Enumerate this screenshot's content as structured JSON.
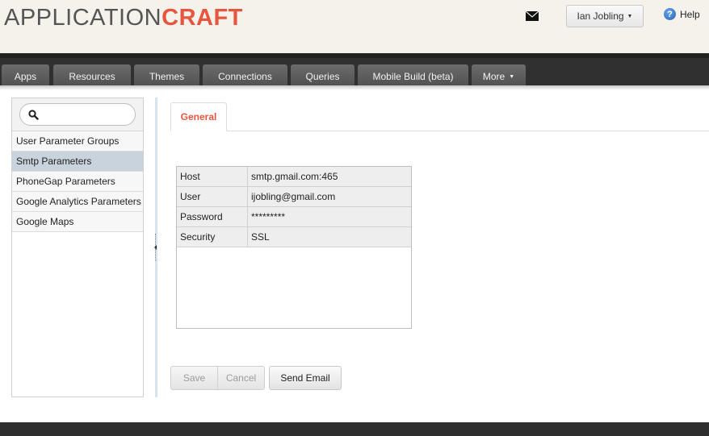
{
  "header": {
    "logo_part1": "APPLICATION",
    "logo_part2": "CRAFT",
    "user_name": "Ian Jobling",
    "help_label": "Help",
    "accent_color": "#e8553f"
  },
  "nav": {
    "tabs": [
      {
        "label": "Apps"
      },
      {
        "label": "Resources"
      },
      {
        "label": "Themes"
      },
      {
        "label": "Connections"
      },
      {
        "label": "Queries"
      },
      {
        "label": "Mobile Build (beta)"
      },
      {
        "label": "More",
        "has_caret": true
      }
    ]
  },
  "sidebar": {
    "search_placeholder": "",
    "items": [
      {
        "label": "User Parameter Groups",
        "selected": false
      },
      {
        "label": "Smtp Parameters",
        "selected": true
      },
      {
        "label": "PhoneGap Parameters",
        "selected": false
      },
      {
        "label": "Google Analytics Parameters",
        "selected": false
      },
      {
        "label": "Google Maps",
        "selected": false
      }
    ]
  },
  "main": {
    "tab_label": "General",
    "properties": [
      {
        "key": "Host",
        "value": "smtp.gmail.com:465"
      },
      {
        "key": "User",
        "value": "ijobling@gmail.com"
      },
      {
        "key": "Password",
        "value": "*********"
      },
      {
        "key": "Security",
        "value": "SSL"
      }
    ],
    "save_label": "Save",
    "cancel_label": "Cancel",
    "send_email_label": "Send Email"
  }
}
